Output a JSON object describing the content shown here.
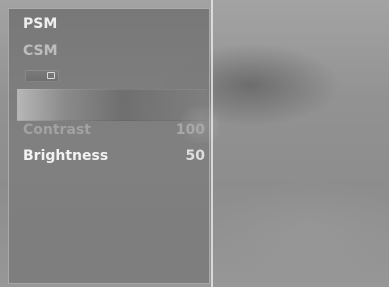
{
  "menu": {
    "items": [
      {
        "label": "PSM"
      },
      {
        "label": "CSM"
      }
    ],
    "settings": [
      {
        "label": "Contrast",
        "value": "100"
      },
      {
        "label": "Brightness",
        "value": "50"
      }
    ]
  },
  "colors": {
    "panel_background": "#7d7d7d",
    "text_primary": "#eeeeee",
    "text_dimmed": "#a2a2a2",
    "divider": "#e8e8e8"
  }
}
